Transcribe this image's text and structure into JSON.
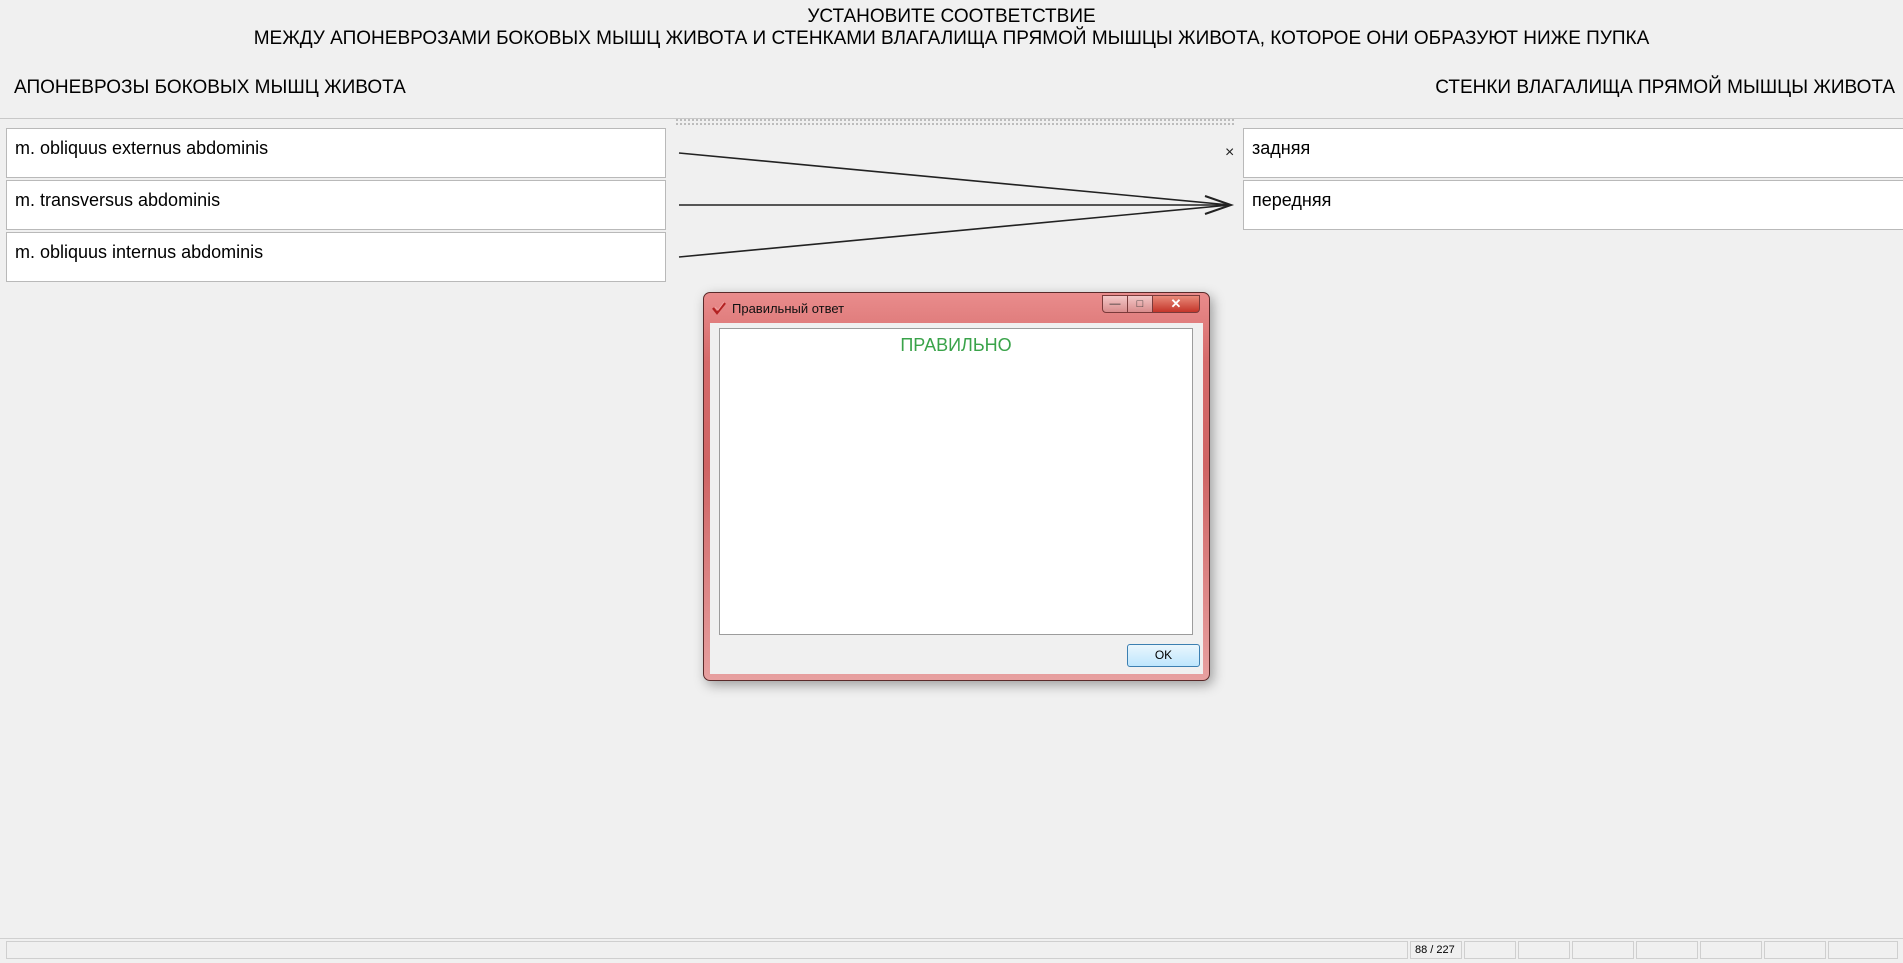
{
  "header": {
    "title_line1": "УСТАНОВИТЕ СООТВЕТСТВИЕ",
    "title_line2": "МЕЖДУ АПОНЕВРОЗАМИ БОКОВЫХ МЫШЦ ЖИВОТА И СТЕНКАМИ ВЛАГАЛИЩА ПРЯМОЙ МЫШЦЫ ЖИВОТА, КОТОРОЕ ОНИ ОБРАЗУЮТ НИЖЕ ПУПКА"
  },
  "columns": {
    "left_header": "АПОНЕВРОЗЫ БОКОВЫХ МЫШЦ ЖИВОТА",
    "right_header": "СТЕНКИ ВЛАГАЛИЩА ПРЯМОЙ МЫШЦЫ ЖИВОТА"
  },
  "left_items": [
    "m. obliquus externus abdominis",
    "m. transversus abdominis",
    "m. obliquus internus abdominis"
  ],
  "right_items": [
    "задняя",
    "передняя"
  ],
  "remove_glyph": "×",
  "dialog": {
    "title": "Правильный ответ",
    "message": "ПРАВИЛЬНО",
    "ok_label": "OK",
    "message_color": "#3aa34a"
  },
  "statusbar": {
    "counter": "88 / 227"
  }
}
